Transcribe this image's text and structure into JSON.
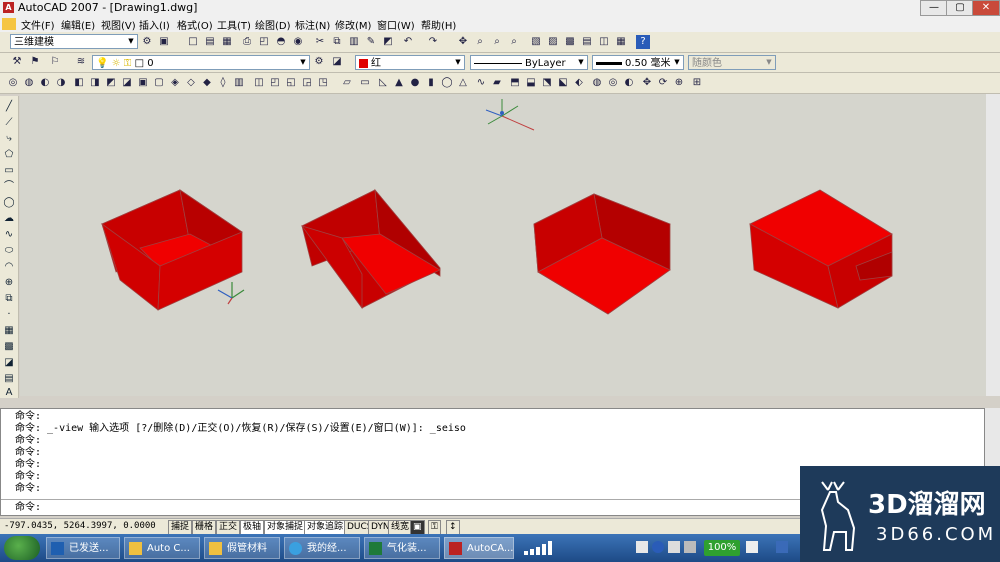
{
  "titlebar": {
    "title": "AutoCAD 2007 - [Drawing1.dwg]",
    "min": "—",
    "max": "▢",
    "close": "✕"
  },
  "menu": {
    "items": [
      "文件(F)",
      "编辑(E)",
      "视图(V)",
      "插入(I)",
      "格式(O)",
      "工具(T)",
      "绘图(D)",
      "标注(N)",
      "修改(M)",
      "窗口(W)",
      "帮助(H)"
    ]
  },
  "toolbar1": {
    "workspace": "三维建模"
  },
  "toolbar2": {
    "layer": "0",
    "color": "红",
    "linetype": "ByLayer",
    "lineweight": "0.50 毫米",
    "plotstyle": "随颜色"
  },
  "commands": {
    "lines": [
      "命令:",
      "命令: _-view 输入选项 [?/删除(D)/正交(O)/恢复(R)/保存(S)/设置(E)/窗口(W)]: _seiso",
      "命令:",
      "命令:",
      "命令:",
      "命令:",
      "命令:"
    ],
    "prompt": "命令:"
  },
  "status": {
    "coords": "-797.0435, 5264.3997, 0.0000",
    "buttons": [
      "捕捉",
      "栅格",
      "正交",
      "极轴",
      "对象捕捉",
      "对象追踪",
      "DUCS",
      "DYN",
      "线宽"
    ]
  },
  "taskbar": {
    "tasks": [
      "已发送...",
      "Auto C...",
      "假管材料",
      "我的经...",
      "气化装...",
      "AutoCA..."
    ],
    "battery": "100%"
  },
  "watermark": {
    "brand": "3D溜溜网",
    "url": "3D66.COM"
  },
  "colors": {
    "box_face_dark": "#c00000",
    "box_face_light": "#e00000",
    "viewport_bg": "#d5d5cd"
  }
}
